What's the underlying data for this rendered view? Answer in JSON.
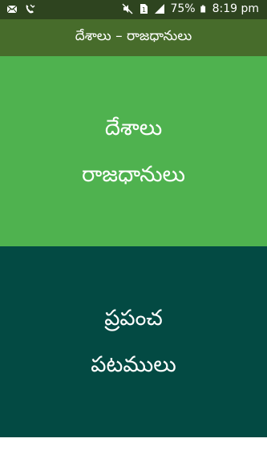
{
  "status_bar": {
    "battery_percent": "75%",
    "time": "8:19 pm",
    "icons": [
      "mail-icon",
      "missed-call-icon",
      "mute-icon",
      "sim-1-icon",
      "signal-icon",
      "battery-icon"
    ],
    "background": "#2e441f"
  },
  "app_bar": {
    "title": "దేశాలు – రాజధానులు",
    "background": "#476c2b"
  },
  "menu": {
    "capitals": {
      "line1": "దేశాలు",
      "line2": "రాజధానులు",
      "background": "#4fb24f"
    },
    "maps": {
      "line1": "ప్రపంచ",
      "line2": "పటములు",
      "background": "#034a43"
    }
  }
}
